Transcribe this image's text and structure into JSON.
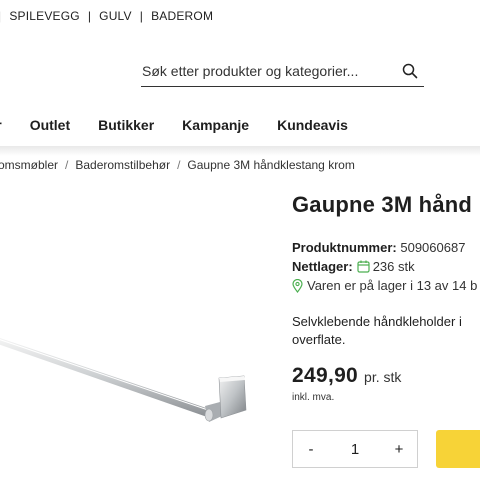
{
  "top_nav": {
    "first": "SPILEVEGG",
    "second": "GULV",
    "third": "BADEROM",
    "separator": "|"
  },
  "search": {
    "placeholder": "Søk etter produkter og kategorier..."
  },
  "main_nav": [
    "eter",
    "Outlet",
    "Butikker",
    "Kampanje",
    "Kundeavis"
  ],
  "breadcrumb": [
    "omsmøbler",
    "Baderomstilbehør",
    "Gaupne 3M håndklestang krom"
  ],
  "breadcrumb_separator": "/",
  "product": {
    "title": "Gaupne 3M hånd",
    "product_number_label": "Produktnummer:",
    "product_number": "509060687",
    "net_stock_label": "Nettlager:",
    "net_stock": "236 stk",
    "store_stock": "Varen er på lager i 13 av 14 b",
    "description": "Selvklebende håndkleholder i overflate.",
    "price": "249,90",
    "price_unit": "pr. stk",
    "vat_note": "inkl. mva.",
    "quantity": "1",
    "minus": "-",
    "plus": "+"
  },
  "colors": {
    "accent_yellow": "#f7d337",
    "stock_green": "#4caf50"
  },
  "icons": {
    "search": "search-icon",
    "calendar": "calendar-icon",
    "location": "location-pin-icon"
  }
}
